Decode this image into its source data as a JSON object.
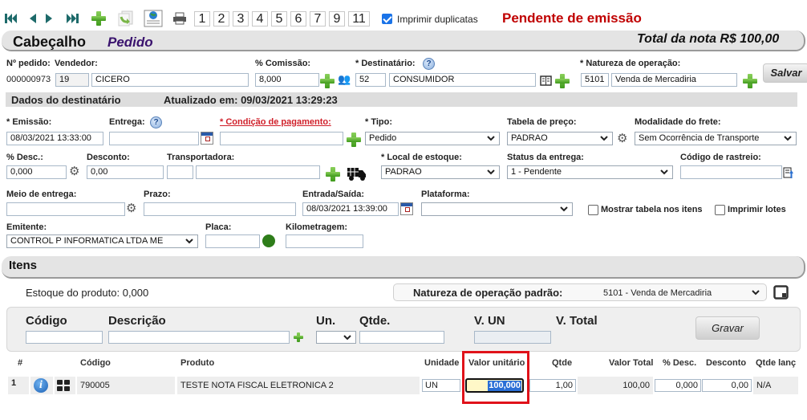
{
  "toolbar": {
    "icons": [
      "first-record-icon",
      "previous-record-icon",
      "next-record-icon",
      "last-record-icon",
      "add-icon",
      "copy-icon",
      "web-icon",
      "print-icon"
    ],
    "page_buttons": [
      "1",
      "2",
      "3",
      "4",
      "5",
      "6",
      "7",
      "9",
      "11"
    ],
    "print_duplicates_label": "Imprimir duplicatas",
    "print_duplicates_checked": true,
    "status_text": "Pendente de emissão",
    "status_color": "#c00000"
  },
  "header": {
    "title": "Cabeçalho",
    "subtitle": "Pedido",
    "total_label": "Total da nota R$ 100,00"
  },
  "order": {
    "number_label": "Nº pedido:",
    "number_value": "000000973",
    "seller_label": "Vendedor:",
    "seller_code": "19",
    "seller_name": "CICERO",
    "commission_label": "% Comissão:",
    "commission_value": "8,000",
    "recipient_label": "* Destinatário:",
    "recipient_code": "52",
    "recipient_name": "CONSUMIDOR",
    "nature_label": "* Natureza de operação:",
    "nature_code": "5101",
    "nature_name": "Venda de Mercadiria",
    "save_label": "Salvar"
  },
  "recipient_band": {
    "title": "Dados do destinatário",
    "updated": "Atualizado em: 09/03/2021 13:29:23"
  },
  "form": {
    "emission_label": "* Emissão:",
    "emission_value": "08/03/2021 13:33:00",
    "delivery_label": "Entrega:",
    "delivery_value": "",
    "payment_label": "* Condição de pagamento:",
    "payment_value": "",
    "type_label": "* Tipo:",
    "type_value": "Pedido",
    "price_table_label": "Tabela de preço:",
    "price_table_value": "PADRAO",
    "freight_label": "Modalidade do frete:",
    "freight_value": "Sem Ocorrência de Transporte",
    "disc_pct_label": "% Desc.:",
    "disc_pct_value": "0,000",
    "discount_label": "Desconto:",
    "discount_value": "0,00",
    "carrier_label": "Transportadora:",
    "carrier_code": "",
    "carrier_name": "",
    "stock_label": "* Local de estoque:",
    "stock_value": "PADRAO",
    "delivery_status_label": "Status da entrega:",
    "delivery_status_value": "1 - Pendente",
    "tracking_label": "Código de rastreio:",
    "tracking_value": "",
    "delivery_method_label": "Meio de entrega:",
    "delivery_method_value": "",
    "term_label": "Prazo:",
    "term_value": "",
    "in_out_label": "Entrada/Saída:",
    "in_out_value": "08/03/2021 13:39:00",
    "platform_label": "Plataforma:",
    "platform_value": "",
    "show_table_label": "Mostrar tabela nos itens",
    "show_table_checked": false,
    "print_lots_label": "Imprimir lotes",
    "print_lots_checked": false,
    "issuer_label": "Emitente:",
    "issuer_value": "CONTROL P INFORMATICA LTDA ME",
    "plate_label": "Placa:",
    "plate_value": "",
    "mileage_label": "Kilometragem:",
    "mileage_value": ""
  },
  "items": {
    "title": "Itens",
    "stock_label": "Estoque do produto:",
    "stock_value": "0,000",
    "default_nature_label": "Natureza de operação padrão:",
    "default_nature_value": "5101 - Venda de Mercadiria",
    "entry": {
      "code_label": "Código",
      "desc_label": "Descrição",
      "unit_label": "Un.",
      "qty_label": "Qtde.",
      "unit_value_label": "V. UN",
      "total_label": "V. Total",
      "save_label": "Gravar"
    },
    "columns": [
      "#",
      "Código",
      "Produto",
      "Unidade",
      "Valor unitário",
      "Qtde",
      "Valor Total",
      "% Desc.",
      "Desconto",
      "Qtde lanç"
    ],
    "rows": [
      {
        "index": "1",
        "code": "790005",
        "product": "TESTE NOTA FISCAL ELETRONICA 2",
        "unit": "UN",
        "unit_value": "100,000",
        "qty": "1,00",
        "total": "100,00",
        "disc_pct": "0,000",
        "discount": "0,00",
        "qty_launched": "N/A"
      }
    ]
  }
}
